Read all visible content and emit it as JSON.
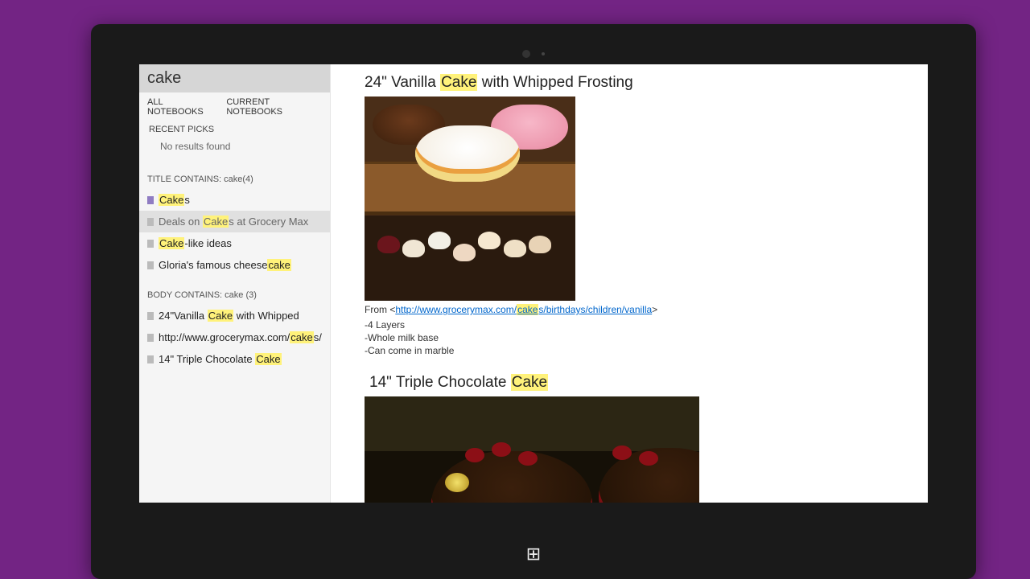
{
  "search": {
    "query": "cake"
  },
  "scope": {
    "all": "ALL NOTEBOOKS",
    "current": "CURRENT NOTEBOOKS"
  },
  "recent": {
    "label": "RECENT PICKS",
    "empty": "No results found"
  },
  "title_group": {
    "head": "TITLE CONTAINS: cake(4)",
    "items": [
      {
        "pre": "",
        "hl": "Cake",
        "post": "s",
        "accent": true,
        "selected": false
      },
      {
        "pre": "Deals on ",
        "hl": "Cake",
        "post": "s at Grocery Max",
        "selected": true
      },
      {
        "pre": "",
        "hl": "Cake",
        "post": "-like ideas",
        "selected": false
      },
      {
        "pre": "Gloria's famous cheese",
        "hl": "cake",
        "post": "",
        "selected": false
      }
    ]
  },
  "body_group": {
    "head": "BODY CONTAINS: cake (3)",
    "items": [
      {
        "pre": "24\"Vanilla ",
        "hl": "Cake",
        "post": " with Whipped"
      },
      {
        "pre": "http://www.grocerymax.com/",
        "hl": "cake",
        "post": "s/"
      },
      {
        "pre": "14\" Triple Chocolate ",
        "hl": "Cake",
        "post": ""
      }
    ]
  },
  "page": {
    "title1_pre": "24\" Vanilla ",
    "title1_hl": "Cake",
    "title1_post": " with Whipped Frosting",
    "source_pre": "From <",
    "source_link_pre": "http://www.grocerymax.com/",
    "source_link_hl": "cake",
    "source_link_post": "s/birthdays/children/vanilla",
    "source_post": ">",
    "bullets": [
      "-4 Layers",
      "-Whole milk base",
      "-Can come in marble"
    ],
    "title2_pre": "14\" Triple Chocolate ",
    "title2_hl": "Cake",
    "title2_post": ""
  },
  "icons": {
    "windows": "⊞"
  }
}
